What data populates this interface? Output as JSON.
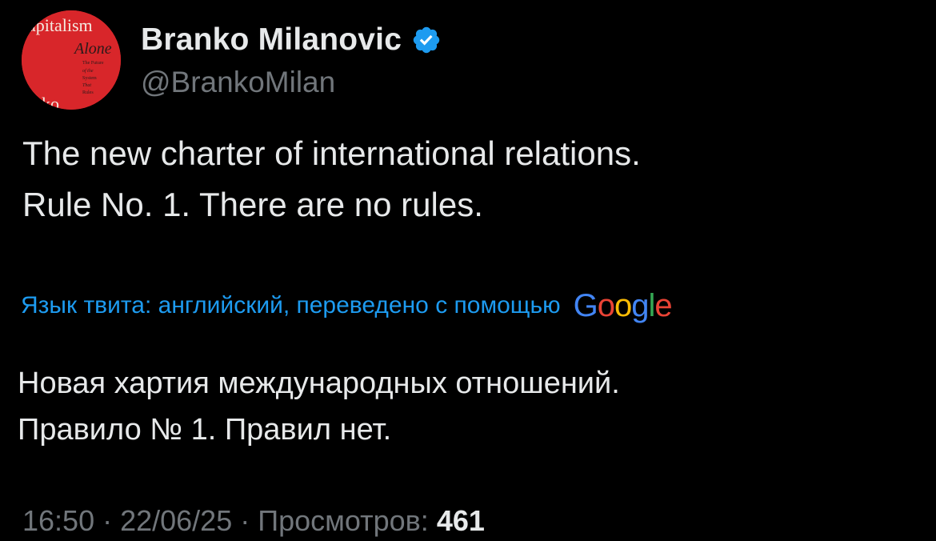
{
  "author": {
    "name": "Branko Milanovic",
    "handle": "@BrankoMilan",
    "verified_color": "#1d9bf0",
    "avatar": {
      "background": "#d8262a",
      "lines": [
        "apitalism",
        "Alone",
        "The Future",
        "of the",
        "System",
        "That",
        "Rules",
        "nko"
      ]
    }
  },
  "tweet": {
    "lines": [
      "The new charter of international relations.",
      "Rule No. 1. There are no rules."
    ]
  },
  "translation": {
    "note": "Язык твита: английский, переведено с помощью",
    "provider_letters": [
      {
        "ch": "G",
        "color": "#4285f4"
      },
      {
        "ch": "o",
        "color": "#ea4335"
      },
      {
        "ch": "o",
        "color": "#fbbc05"
      },
      {
        "ch": "g",
        "color": "#4285f4"
      },
      {
        "ch": "l",
        "color": "#34a853"
      },
      {
        "ch": "e",
        "color": "#ea4335"
      }
    ],
    "lines": [
      "Новая хартия международных отношений.",
      "Правило № 1. Правил нет."
    ]
  },
  "meta": {
    "time": "16:50",
    "separator": " · ",
    "date": "22/06/25",
    "views_label": "Просмотров:",
    "views_count": "461"
  }
}
